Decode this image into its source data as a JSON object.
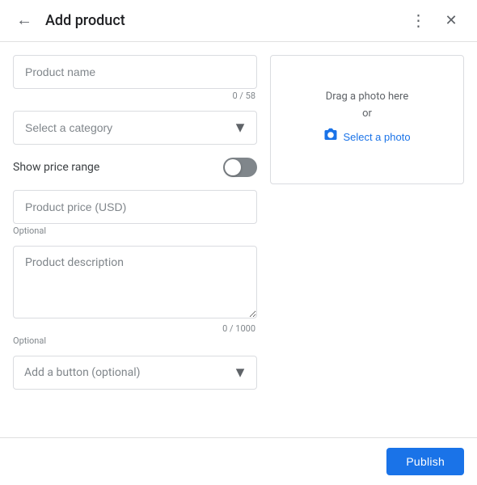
{
  "header": {
    "title": "Add product",
    "back_label": "←",
    "more_label": "⋮",
    "close_label": "✕"
  },
  "form": {
    "product_name": {
      "placeholder": "Product name",
      "char_count": "0 / 58"
    },
    "category": {
      "placeholder": "Select a category"
    },
    "show_price_range": {
      "label": "Show price range"
    },
    "product_price": {
      "placeholder": "Product price (USD)",
      "optional": "Optional"
    },
    "product_description": {
      "placeholder": "Product description",
      "char_count": "0 / 1000",
      "optional": "Optional"
    },
    "button_dropdown": {
      "placeholder": "Add a button (optional)"
    }
  },
  "photo": {
    "drag_text": "Drag a photo here",
    "or_text": "or",
    "select_label": "Select a photo"
  },
  "footer": {
    "publish_label": "Publish"
  }
}
